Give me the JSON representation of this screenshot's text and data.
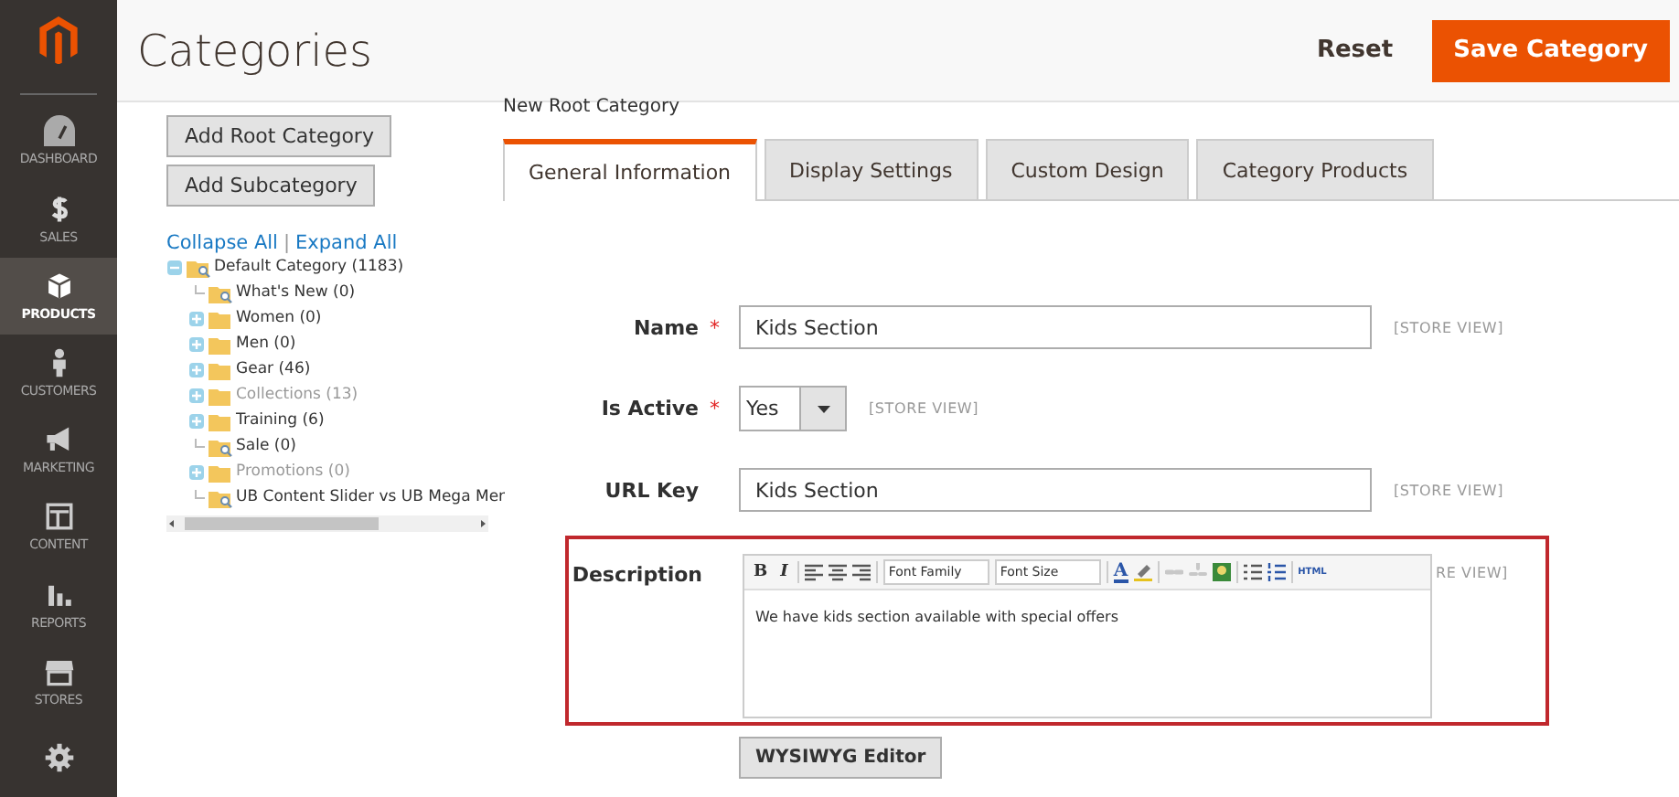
{
  "sidebar": {
    "items": [
      {
        "label": "DASHBOARD",
        "selected": false
      },
      {
        "label": "SALES",
        "selected": false
      },
      {
        "label": "PRODUCTS",
        "selected": true
      },
      {
        "label": "CUSTOMERS",
        "selected": false
      },
      {
        "label": "MARKETING",
        "selected": false
      },
      {
        "label": "CONTENT",
        "selected": false
      },
      {
        "label": "REPORTS",
        "selected": false
      },
      {
        "label": "STORES",
        "selected": false
      },
      {
        "selected": false
      }
    ]
  },
  "header": {
    "title": "Categories",
    "reset": "Reset",
    "save": "Save Category"
  },
  "tree_panel": {
    "buttons": [
      "Add Root Category",
      "Add Subcategory"
    ],
    "collapse_all": "Collapse All",
    "separator": "|",
    "expand_all": "Expand All",
    "tree": [
      {
        "label": "Default Category (1183)",
        "kind": "branch",
        "expanded": true,
        "disabled": false,
        "children": [
          {
            "label": "What's New (0)",
            "kind": "leaf",
            "disabled": false
          },
          {
            "label": "Women (0)",
            "kind": "branch",
            "expanded": false,
            "disabled": false
          },
          {
            "label": "Men (0)",
            "kind": "branch",
            "expanded": false,
            "disabled": false
          },
          {
            "label": "Gear (46)",
            "kind": "branch",
            "expanded": false,
            "disabled": false
          },
          {
            "label": "Collections (13)",
            "kind": "branch",
            "expanded": false,
            "disabled": true
          },
          {
            "label": "Training (6)",
            "kind": "branch",
            "expanded": false,
            "disabled": false
          },
          {
            "label": "Sale (0)",
            "kind": "leaf",
            "disabled": false
          },
          {
            "label": "Promotions (0)",
            "kind": "branch",
            "expanded": false,
            "disabled": true
          },
          {
            "label": "UB Content Slider vs UB Mega Mer",
            "kind": "leaf",
            "disabled": false
          }
        ]
      }
    ]
  },
  "editor_panel": {
    "heading": "New Root Category",
    "tabs": [
      {
        "label": "General Information",
        "selected": true
      },
      {
        "label": "Display Settings",
        "selected": false
      },
      {
        "label": "Custom Design",
        "selected": false
      },
      {
        "label": "Category Products",
        "selected": false
      }
    ],
    "fields": [
      {
        "kind": "text",
        "label": "Name",
        "required_mark": "*",
        "value": "Kids Section",
        "scope": "[STORE VIEW]",
        "highlighted": false
      },
      {
        "kind": "select",
        "label": "Is Active",
        "required_mark": "*",
        "value": "Yes",
        "scope": "[STORE VIEW]",
        "highlighted": false
      },
      {
        "kind": "text",
        "label": "URL Key",
        "value": "Kids Section",
        "scope": "[STORE VIEW]",
        "highlighted": false
      },
      {
        "kind": "editor",
        "label": "Description",
        "value": "We have kids section available with special offers",
        "scope": "RE VIEW]",
        "highlighted": true
      }
    ],
    "toolbar": {
      "bold": "B",
      "italic": "I",
      "font_family": "Font Family",
      "font_size": "Font Size",
      "text_color": "A",
      "link_disabled": true,
      "html": "HTML"
    },
    "wysiwyg_button": "WYSIWYG Editor"
  }
}
